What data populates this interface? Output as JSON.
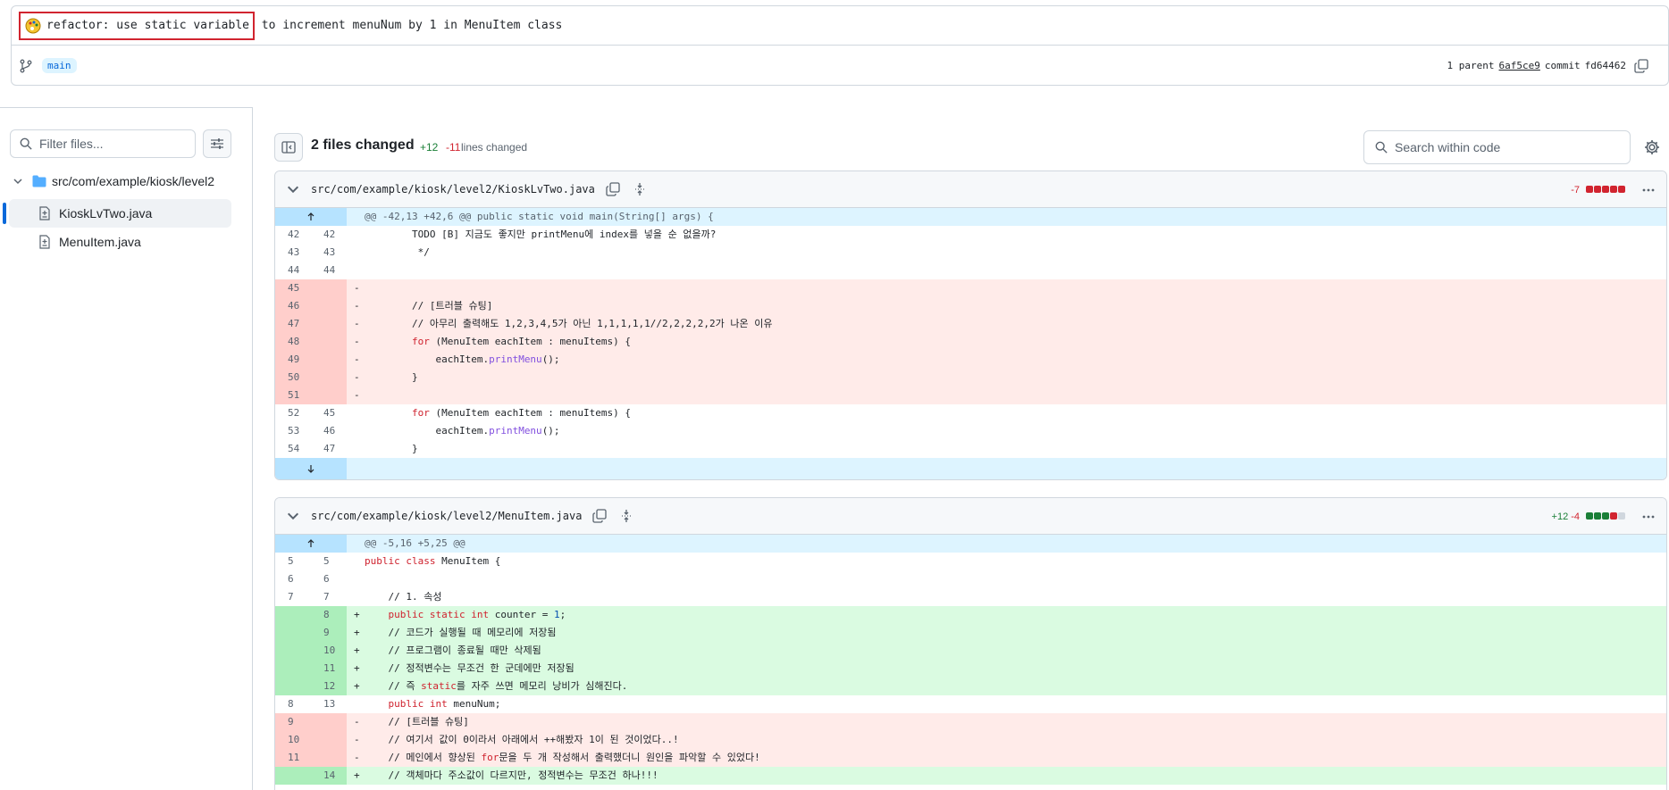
{
  "commit": {
    "title_highlighted": "refactor: use static variable",
    "title_rest": " to increment menuNum by 1 in MenuItem class",
    "branch": "main",
    "parent_label": "1 parent",
    "parent_sha": "6af5ce9",
    "commit_label": "commit",
    "commit_sha": "fd64462"
  },
  "sidebar": {
    "filter_placeholder": "Filter files...",
    "folder": "src/com/example/kiosk/level2",
    "files": [
      {
        "name": "KioskLvTwo.java",
        "selected": true
      },
      {
        "name": "MenuItem.java",
        "selected": false
      }
    ]
  },
  "toolbar": {
    "files_changed": "2 files changed",
    "additions": "+12",
    "deletions": "-11",
    "lines_changed": "lines changed",
    "search_placeholder": "Search within code"
  },
  "diffs": [
    {
      "path": "src/com/example/kiosk/level2/KioskLvTwo.java",
      "additions": "",
      "deletions": "-7",
      "bar": [
        "del",
        "del",
        "del",
        "del",
        "del"
      ],
      "hunk": "@@ -42,13 +42,6 @@ public static void main(String[] args) {",
      "rows": [
        {
          "type": "ctx",
          "old": "42",
          "new": "42",
          "code": "        TODO [B] 지금도 좋지만 printMenu에 index를 넣을 순 없을까?"
        },
        {
          "type": "ctx",
          "old": "43",
          "new": "43",
          "code": "         */"
        },
        {
          "type": "ctx",
          "old": "44",
          "new": "44",
          "code": ""
        },
        {
          "type": "del",
          "old": "45",
          "new": "",
          "code": ""
        },
        {
          "type": "del",
          "old": "46",
          "new": "",
          "code": "        // [트러블 슈팅]"
        },
        {
          "type": "del",
          "old": "47",
          "new": "",
          "code": "        // 아무리 출력해도 1,2,3,4,5가 아닌 1,1,1,1,1//2,2,2,2,2가 나온 이유"
        },
        {
          "type": "del",
          "old": "48",
          "new": "",
          "code": "        for (MenuItem eachItem : menuItems) {"
        },
        {
          "type": "del",
          "old": "49",
          "new": "",
          "code": "            eachItem.printMenu();"
        },
        {
          "type": "del",
          "old": "50",
          "new": "",
          "code": "        }"
        },
        {
          "type": "del",
          "old": "51",
          "new": "",
          "code": ""
        },
        {
          "type": "ctx",
          "old": "52",
          "new": "45",
          "code": "        for (MenuItem eachItem : menuItems) {"
        },
        {
          "type": "ctx",
          "old": "53",
          "new": "46",
          "code": "            eachItem.printMenu();"
        },
        {
          "type": "ctx",
          "old": "54",
          "new": "47",
          "code": "        }"
        }
      ]
    },
    {
      "path": "src/com/example/kiosk/level2/MenuItem.java",
      "additions": "+12",
      "deletions": "-4",
      "bar": [
        "add",
        "add",
        "add",
        "del",
        "neu"
      ],
      "hunk": "@@ -5,16 +5,25 @@",
      "rows": [
        {
          "type": "ctx",
          "old": "5",
          "new": "5",
          "code": "public class MenuItem {"
        },
        {
          "type": "ctx",
          "old": "6",
          "new": "6",
          "code": ""
        },
        {
          "type": "ctx",
          "old": "7",
          "new": "7",
          "code": "    // 1. 속성"
        },
        {
          "type": "add",
          "old": "",
          "new": "8",
          "code": "    public static int counter = 1;"
        },
        {
          "type": "add",
          "old": "",
          "new": "9",
          "code": "    // 코드가 실행될 때 메모리에 저장됨"
        },
        {
          "type": "add",
          "old": "",
          "new": "10",
          "code": "    // 프로그램이 종료될 때만 삭제됨"
        },
        {
          "type": "add",
          "old": "",
          "new": "11",
          "code": "    // 정적변수는 무조건 한 군데에만 저장됨"
        },
        {
          "type": "add",
          "old": "",
          "new": "12",
          "code": "    // 즉 static를 자주 쓰면 메모리 낭비가 심해진다."
        },
        {
          "type": "ctx",
          "old": "8",
          "new": "13",
          "code": "    public int menuNum;"
        },
        {
          "type": "del",
          "old": "9",
          "new": "",
          "code": "    // [트러블 슈팅]"
        },
        {
          "type": "del",
          "old": "10",
          "new": "",
          "code": "    // 여기서 값이 0이라서 아래에서 ++해봤자 1이 된 것이었다..!"
        },
        {
          "type": "del",
          "old": "11",
          "new": "",
          "code": "    // 메인에서 향상된 for문을 두 개 작성해서 출력했더니 원인을 파악할 수 있었다!"
        },
        {
          "type": "add",
          "old": "",
          "new": "14",
          "code": "    // 객체마다 주소값이 다르지만, 정적변수는 무조건 하나!!!"
        }
      ]
    }
  ]
}
